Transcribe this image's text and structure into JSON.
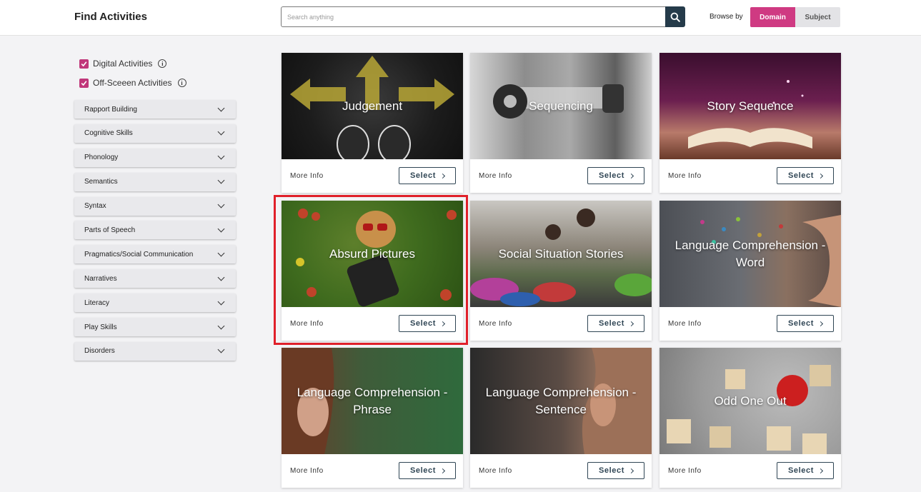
{
  "header": {
    "title": "Find Activities",
    "search_placeholder": "Search anything",
    "browse_label": "Browse by",
    "browse_options": [
      "Domain",
      "Subject"
    ],
    "active_browse": "Domain"
  },
  "filters": {
    "checkboxes": [
      {
        "label": "Digital Activities",
        "checked": true
      },
      {
        "label": "Off-Sceeen Activities",
        "checked": true
      }
    ],
    "domains": [
      "Rapport Building",
      "Cognitive Skills",
      "Phonology",
      "Semantics",
      "Syntax",
      "Parts of Speech",
      "Pragmatics/Social Communication",
      "Narratives",
      "Literacy",
      "Play Skills",
      "Disorders"
    ]
  },
  "cards": [
    {
      "title": "Judgement",
      "more_info": "More Info",
      "select": "Select"
    },
    {
      "title": "Sequencing",
      "more_info": "More Info",
      "select": "Select"
    },
    {
      "title": "Story Sequence",
      "more_info": "More Info",
      "select": "Select"
    },
    {
      "title": "Absurd Pictures",
      "more_info": "More Info",
      "select": "Select"
    },
    {
      "title": "Social Situation Stories",
      "more_info": "More Info",
      "select": "Select"
    },
    {
      "title": "Language Comprehension - Word",
      "more_info": "More Info",
      "select": "Select"
    },
    {
      "title": "Language Comprehension - Phrase",
      "more_info": "More Info",
      "select": "Select"
    },
    {
      "title": "Language Comprehension - Sentence",
      "more_info": "More Info",
      "select": "Select"
    },
    {
      "title": "Odd One Out",
      "more_info": "More Info",
      "select": "Select"
    }
  ],
  "colors": {
    "accent": "#cf3a82",
    "checkbox": "#c0377a",
    "search_button": "#253b4a",
    "highlight_border": "#e0202a",
    "select_text": "#2f4554"
  },
  "icons": {
    "search": "search-icon",
    "info": "info-icon",
    "chevron": "chevron-down-icon",
    "select_arrow": "chevron-right-icon",
    "check": "check-icon"
  }
}
